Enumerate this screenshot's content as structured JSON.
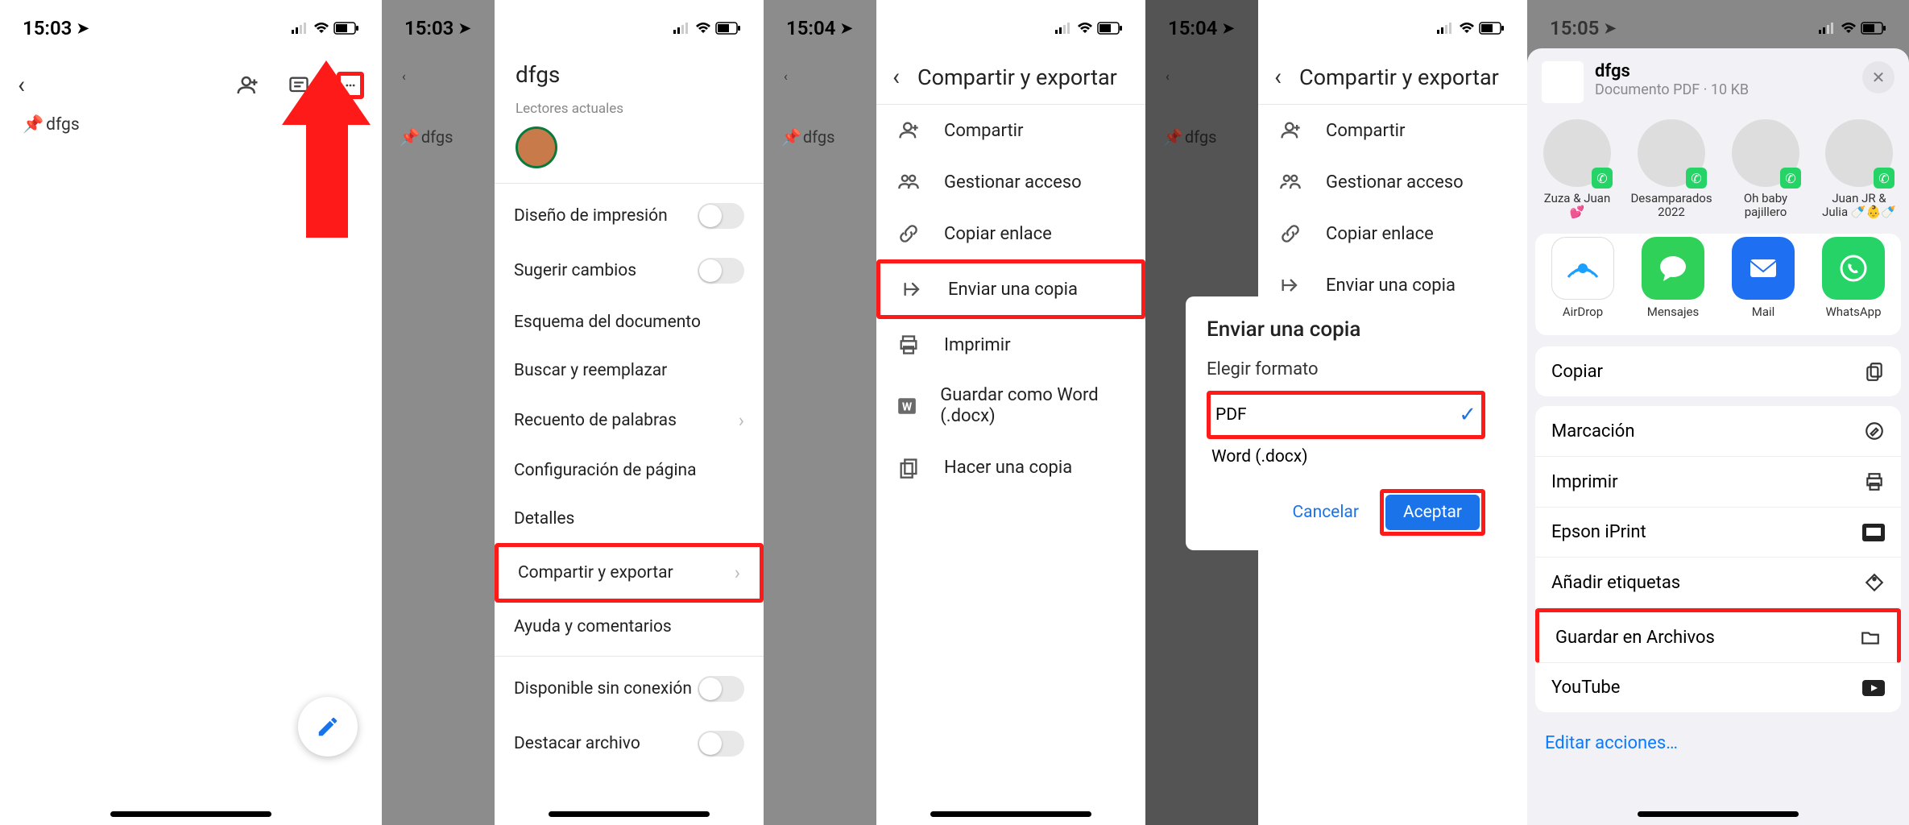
{
  "status": {
    "times": [
      "15:03",
      "15:03",
      "15:04",
      "15:04",
      "15:05"
    ]
  },
  "doc": {
    "name": "dfgs"
  },
  "menu": {
    "title": "dfgs",
    "readers_label": "Lectores actuales",
    "items": {
      "print_layout": "Diseño de impresión",
      "suggest": "Sugerir cambios",
      "outline": "Esquema del documento",
      "find": "Buscar y reemplazar",
      "wordcount": "Recuento de palabras",
      "pagesetup": "Configuración de página",
      "details": "Detalles",
      "share_export": "Compartir y exportar",
      "help": "Ayuda y comentarios",
      "offline": "Disponible sin conexión",
      "star": "Destacar archivo"
    }
  },
  "share": {
    "title": "Compartir y exportar",
    "items": {
      "share": "Compartir",
      "manage": "Gestionar acceso",
      "copylink": "Copiar enlace",
      "sendcopy": "Enviar una copia",
      "print": "Imprimir",
      "saveword": "Guardar como Word (.docx)",
      "makecopy": "Hacer una copia"
    }
  },
  "dialog": {
    "title": "Enviar una copia",
    "choose": "Elegir formato",
    "pdf": "PDF",
    "word": "Word (.docx)",
    "cancel": "Cancelar",
    "accept": "Aceptar"
  },
  "sheet": {
    "filename": "dfgs",
    "subtitle": "Documento PDF · 10 KB",
    "people": [
      {
        "name": "Zuza & Juan 💕"
      },
      {
        "name": "Desamparados 2022"
      },
      {
        "name": "Oh baby pajillero"
      },
      {
        "name": "Juan JR & Julia 🍼👶🍼"
      }
    ],
    "apps": [
      {
        "name": "AirDrop",
        "color": "#fff",
        "bd": "#d0d0d0"
      },
      {
        "name": "Mensajes",
        "color": "#30d158"
      },
      {
        "name": "Mail",
        "color": "#1f6ff2"
      },
      {
        "name": "WhatsApp",
        "color": "#25d366"
      }
    ],
    "actions": {
      "copy": "Copiar",
      "markup": "Marcación",
      "print": "Imprimir",
      "epson": "Epson iPrint",
      "tags": "Añadir etiquetas",
      "save": "Guardar en Archivos",
      "youtube": "YouTube",
      "edit": "Editar acciones…"
    }
  }
}
